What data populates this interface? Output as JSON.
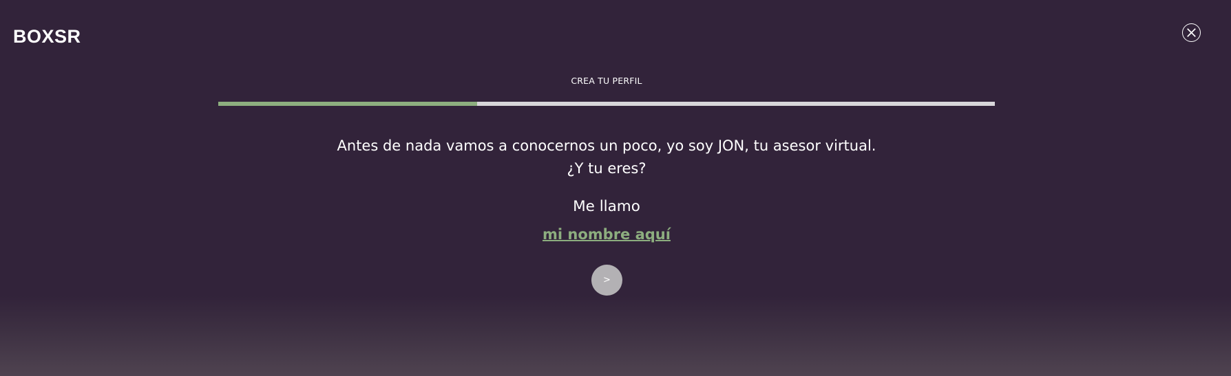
{
  "header": {
    "logo_text": "BOXSR",
    "close_icon": "close-circle-icon"
  },
  "progress": {
    "title": "CREA TU PERFIL",
    "fraction": 0.333,
    "fill_color": "#8dae7f",
    "track_color": "#d8d6da"
  },
  "intro": {
    "line1": "Antes de nada vamos a conocernos un poco, yo soy JON, tu asesor virtual.",
    "line2": "¿Y tu eres?"
  },
  "name_form": {
    "label": "Me llamo",
    "placeholder": "mi nombre aquí",
    "value": "",
    "accent_color": "#8dae7f"
  },
  "next_button": {
    "label": ">"
  },
  "colors": {
    "background": "#32233a"
  }
}
